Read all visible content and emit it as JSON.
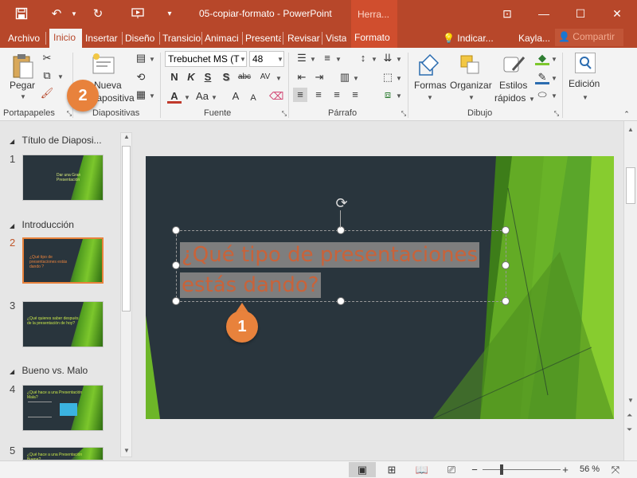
{
  "window": {
    "title": "05-copiar-formato - PowerPoint",
    "context_tab": "Herra...",
    "user": "Kayla...",
    "share": "Compartir",
    "tell_me": "Indicar..."
  },
  "tabs": [
    "Archivo",
    "Inicio",
    "Insertar",
    "Diseño",
    "Transicio",
    "Animaci",
    "Presenta",
    "Revisar",
    "Vista",
    "Formato"
  ],
  "ribbon": {
    "clipboard": {
      "label": "Portapapeles",
      "paste": "Pegar"
    },
    "slides": {
      "label": "Diapositivas",
      "new_slide_1": "Nueva",
      "new_slide_2": "diapositiva"
    },
    "font": {
      "label": "Fuente",
      "name": "Trebuchet MS (T",
      "size": "48",
      "bold": "N",
      "italic": "K",
      "underline": "S",
      "shadow": "S",
      "strike": "abc",
      "spacing": "AV",
      "case": "Aa",
      "grow": "A",
      "shrink": "A"
    },
    "paragraph": {
      "label": "Párrafo"
    },
    "drawing": {
      "label": "Dibujo",
      "shapes": "Formas",
      "arrange": "Organizar",
      "styles_1": "Estilos",
      "styles_2": "rápidos"
    },
    "editing": {
      "label": "Edición"
    }
  },
  "slides_panel": {
    "sections": [
      {
        "name": "Título de Diaposi..."
      },
      {
        "name": "Introducción"
      },
      {
        "name": "Bueno vs. Malo"
      }
    ],
    "slides": [
      {
        "num": "1",
        "text": "Dar una Gran Presentación"
      },
      {
        "num": "2",
        "text": "¿Qué tipo de presentaciones estás dando ?"
      },
      {
        "num": "3",
        "text": "¿Qué quieres saber después de la presentación de hoy?"
      },
      {
        "num": "4",
        "text": "¿Qué hace a una Presentación Mala?"
      },
      {
        "num": "5",
        "text": "¿Qué hace a una Presentación Buena?"
      }
    ]
  },
  "slide": {
    "title_line1": "¿Qué tipo de presentaciones",
    "title_line2": "estás dando?"
  },
  "callouts": {
    "one": "1",
    "two": "2"
  },
  "status": {
    "zoom": "56 %"
  },
  "colors": {
    "accent": "#b7472a",
    "callout": "#e8823c",
    "slide_bg": "#29353d",
    "green": "#7cc72c",
    "title_text": "#c8633a"
  }
}
